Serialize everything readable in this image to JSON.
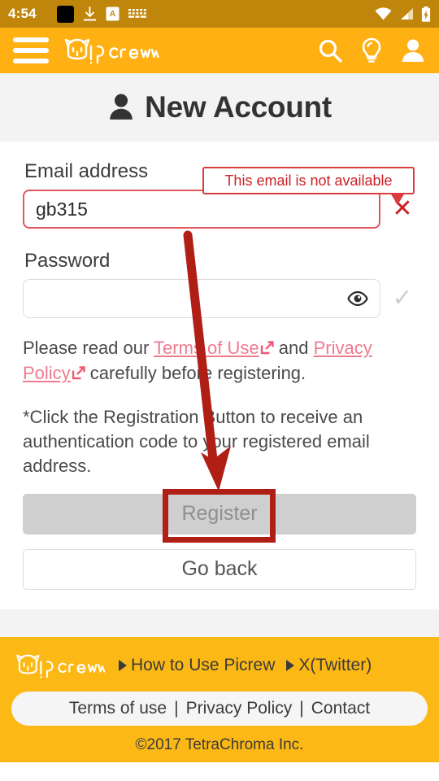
{
  "statusbar": {
    "time": "4:54",
    "icons_left": [
      "black-square-icon",
      "download-icon",
      "screenshot-a-icon",
      "keyboard-icon"
    ],
    "icons_right": [
      "wifi-icon",
      "cellular-signal-icon",
      "battery-charging-icon"
    ]
  },
  "appbar": {
    "menu_icon": "hamburger-menu-icon",
    "logo_text": "Picrew",
    "search_icon": "search-icon",
    "idea_icon": "lightbulb-icon",
    "account_icon": "person-icon",
    "background_color": "#ffb013"
  },
  "page": {
    "title": "New Account",
    "title_icon": "person-icon"
  },
  "form": {
    "email_label": "Email address",
    "email_value": "gb315",
    "email_placeholder": "",
    "email_error": "This email is not available",
    "email_clear_icon": "close-x-icon",
    "password_label": "Password",
    "password_value": "",
    "password_placeholder": "",
    "password_toggle_icon": "eye-icon",
    "password_valid_icon": "checkmark-icon",
    "terms_text_before": "Please read our ",
    "terms_link": "Terms of Use",
    "terms_text_middle": " and ",
    "privacy_link": "Privacy Policy",
    "terms_text_after": " carefully before registering.",
    "note": "*Click the Registration Button to receive an authentication code to your registered email address.",
    "register_label": "Register",
    "goback_label": "Go back"
  },
  "footer": {
    "logo_text": "Picrew",
    "links": [
      {
        "label": "How to Use Picrew"
      },
      {
        "label": "X(Twitter)"
      }
    ],
    "pill": {
      "terms": "Terms of use",
      "separator": "|",
      "privacy": "Privacy Policy",
      "contact": "Contact"
    },
    "copyright": "©2017 TetraChroma Inc.",
    "background_color": "#fcb814"
  },
  "annotations": {
    "arrow_color": "#b01f15",
    "highlight_color": "#b01f15",
    "highlight_target": "Register",
    "error_border_color": "#d93b3f"
  }
}
